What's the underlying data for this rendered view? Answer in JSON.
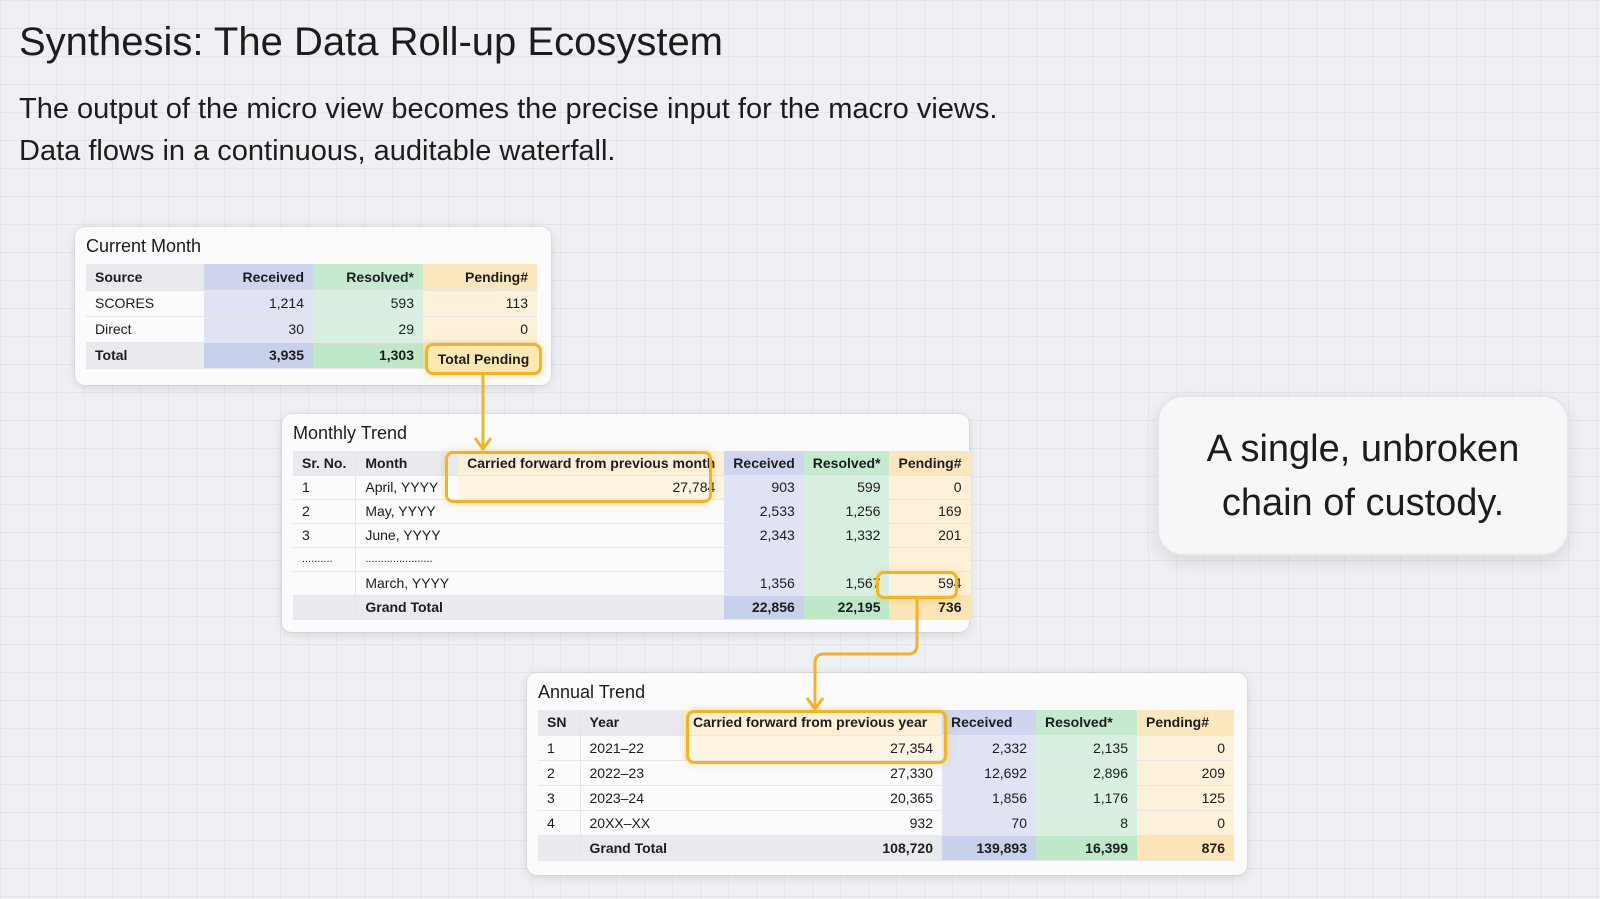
{
  "title": "Synthesis: The Data Roll-up Ecosystem",
  "subtitle_lines": [
    "The output of the micro view becomes the precise input for the macro views.",
    "Data flows in a continuous, auditable waterfall."
  ],
  "callout": {
    "line1": "A single, unbroken",
    "line2": "chain of custody."
  },
  "current_month": {
    "title": "Current Month",
    "headers": [
      "Source",
      "Received",
      "Resolved*",
      "Pending#"
    ],
    "rows": [
      [
        "SCORES",
        "1,214",
        "593",
        "113"
      ],
      [
        "Direct",
        "30",
        "29",
        "0"
      ]
    ],
    "total": [
      "Total",
      "3,935",
      "1,303",
      "Total Pending"
    ]
  },
  "monthly_trend": {
    "title": "Monthly Trend",
    "headers": [
      "Sr. No.",
      "Month",
      "Carried forward from previous month",
      "Received",
      "Resolved*",
      "Pending#"
    ],
    "rows": [
      [
        "1",
        "April, YYYY",
        "27,784",
        "903",
        "599",
        "0"
      ],
      [
        "2",
        "May, YYYY",
        "",
        "2,533",
        "1,256",
        "169"
      ],
      [
        "3",
        "June, YYYY",
        "",
        "2,343",
        "1,332",
        "201"
      ],
      [
        "..........",
        "......................",
        "",
        "",
        "",
        ""
      ],
      [
        "",
        "March, YYYY",
        "",
        "1,356",
        "1,567",
        "594"
      ]
    ],
    "total": [
      "",
      "Grand Total",
      "",
      "22,856",
      "22,195",
      "736"
    ]
  },
  "annual_trend": {
    "title": "Annual Trend",
    "headers": [
      "SN",
      "Year",
      "Carried forward from previous year",
      "Received",
      "Resolved*",
      "Pending#"
    ],
    "rows": [
      [
        "1",
        "2021–22",
        "27,354",
        "2,332",
        "2,135",
        "0"
      ],
      [
        "2",
        "2022–23",
        "27,330",
        "12,692",
        "2,896",
        "209"
      ],
      [
        "3",
        "2023–24",
        "20,365",
        "1,856",
        "1,176",
        "125"
      ],
      [
        "4",
        "20XX–XX",
        "932",
        "70",
        "8",
        "0"
      ]
    ],
    "total": [
      "",
      "Grand Total",
      "108,720",
      "139,893",
      "16,399",
      "876"
    ]
  },
  "colors": {
    "highlight": "#f0b429",
    "received": "#dfe3f3",
    "resolved": "#d9f0e0",
    "pending": "#fdf1d9"
  }
}
